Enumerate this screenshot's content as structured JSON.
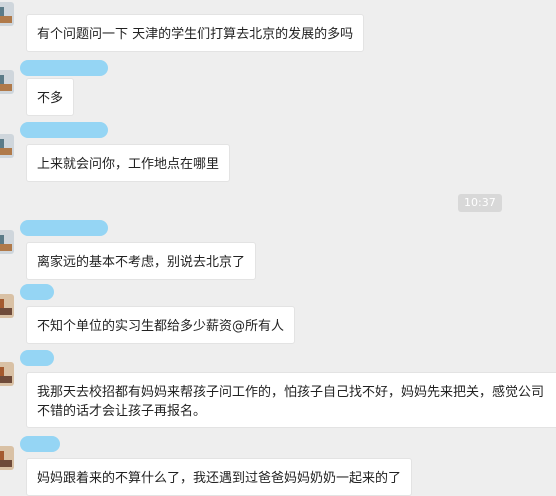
{
  "timestamp": "10:37",
  "messages": [
    {
      "id": "m1",
      "text": "有个问题问一下 天津的学生们打算去北京的发展的多吗"
    },
    {
      "id": "m2",
      "text": "不多"
    },
    {
      "id": "m3",
      "text": "上来就会问你，工作地点在哪里"
    },
    {
      "id": "m4",
      "text": "离家远的基本不考虑，别说去北京了"
    },
    {
      "id": "m5",
      "text": "不知个单位的实习生都给多少薪资@所有人"
    },
    {
      "id": "m6",
      "text": "我那天去校招都有妈妈来帮孩子问工作的，怕孩子自己找不好，妈妈先来把关，感觉公司不错的话才会让孩子再报名。"
    },
    {
      "id": "m7",
      "text": "妈妈跟着来的不算什么了，我还遇到过爸爸妈妈奶奶一起来的了"
    }
  ]
}
